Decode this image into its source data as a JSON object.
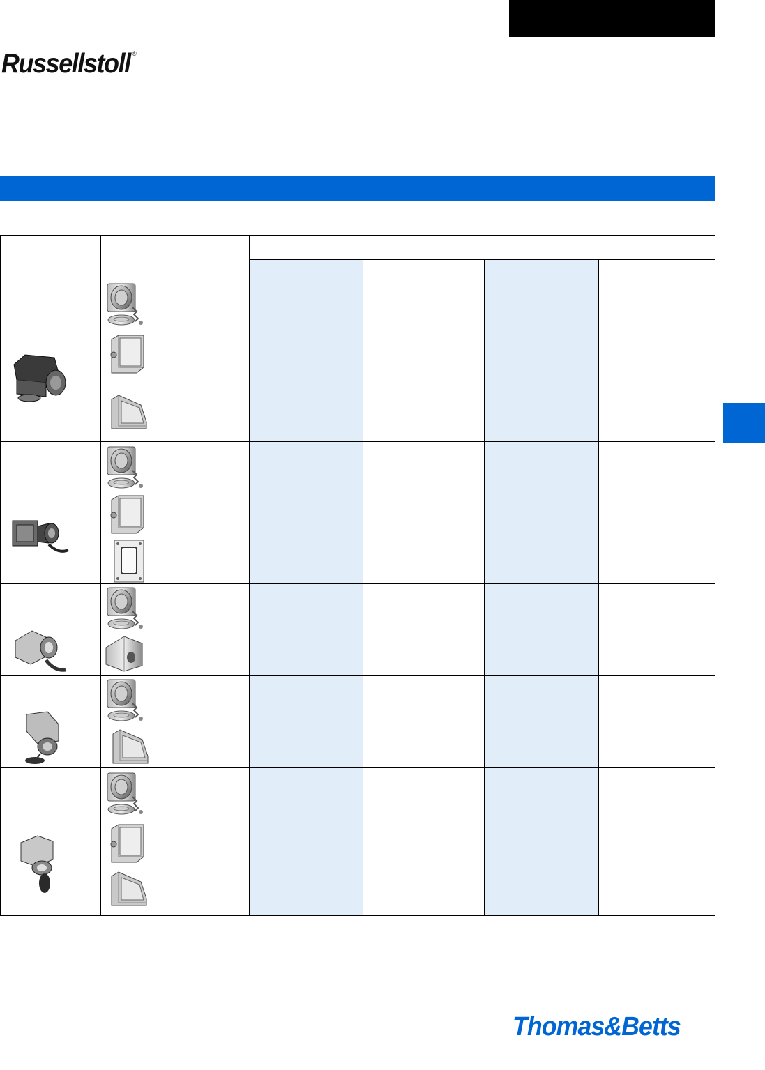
{
  "header": {
    "brand": "Russellstoll",
    "registered_mark": "®"
  },
  "footer": {
    "brand": "Thomas&Betts"
  },
  "colors": {
    "accent_blue": "#0066d3",
    "shaded_column": "#e1eefa",
    "header_tab": "#000000"
  },
  "table": {
    "header_row": [
      "",
      "",
      ""
    ],
    "sub_header": [
      "",
      "",
      "",
      ""
    ],
    "rows": [
      {
        "product_icon": "receptacle-angle-housing-icon",
        "component_icons": [
          "receptacle-with-cap-icon",
          "back-box-icon",
          "angle-adapter-icon"
        ]
      },
      {
        "product_icon": "receptacle-box-housing-icon",
        "component_icons": [
          "receptacle-with-cap-icon",
          "back-box-icon",
          "flange-plate-icon"
        ]
      },
      {
        "product_icon": "receptacle-hood-housing-icon",
        "component_icons": [
          "receptacle-with-cap-icon",
          "hood-adapter-icon"
        ]
      },
      {
        "product_icon": "receptacle-elbow-housing-icon",
        "component_icons": [
          "receptacle-with-cap-icon",
          "angle-adapter-icon"
        ]
      },
      {
        "product_icon": "receptacle-elbow-down-housing-icon",
        "component_icons": [
          "receptacle-with-cap-icon",
          "back-box-icon",
          "angle-adapter-icon"
        ]
      }
    ]
  }
}
